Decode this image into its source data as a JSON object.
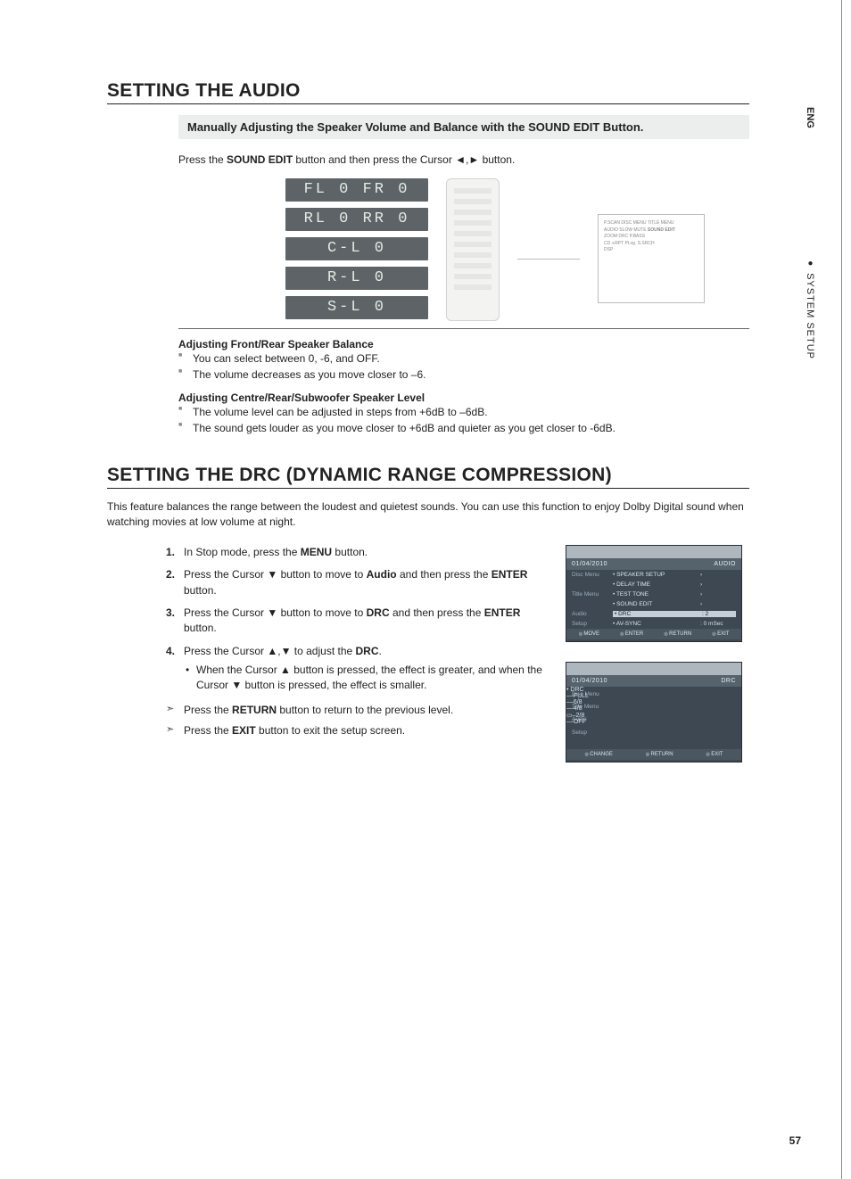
{
  "sideTab": "ENG",
  "sideSection": "SYSTEM SETUP",
  "section1": {
    "title": "SETTING THE AUDIO",
    "subhead": "Manually Adjusting the Speaker Volume and Balance with the SOUND EDIT Button.",
    "intro_pre": "Press the ",
    "intro_bold1": "SOUND EDIT",
    "intro_mid": " button and then press the Cursor ◄,► button.",
    "displays": [
      "FL 0 FR 0",
      "RL 0 RR 0",
      "C-L   0",
      "R-L   0",
      "S-L   0"
    ],
    "blockA_head": "Adjusting Front/Rear Speaker Balance",
    "blockA_items": [
      "You can select between 0, -6, and OFF.",
      "The volume decreases as you move closer to –6."
    ],
    "blockB_head": "Adjusting Centre/Rear/Subwoofer Speaker Level",
    "blockB_items": [
      "The volume level can be adjusted in steps from +6dB to –6dB.",
      "The sound gets louder as you move closer to +6dB and quieter as you get closer to -6dB."
    ]
  },
  "section2": {
    "title": "SETTING THE DRC (DYNAMIC RANGE COMPRESSION)",
    "desc": "This feature balances the range between the loudest and quietest sounds. You can use this function to enjoy Dolby Digital sound when watching movies at low volume at night.",
    "steps": [
      {
        "num": "1.",
        "parts": [
          "In Stop mode, press the ",
          "MENU",
          " button."
        ]
      },
      {
        "num": "2.",
        "parts": [
          "Press the Cursor ▼ button to move to ",
          "Audio",
          " and then press the ",
          "ENTER",
          " button."
        ]
      },
      {
        "num": "3.",
        "parts": [
          "Press the Cursor ▼ button to move to ",
          "DRC",
          " and then press the ",
          "ENTER",
          " button."
        ]
      },
      {
        "num": "4.",
        "parts": [
          "Press the Cursor ▲,▼ to adjust the ",
          "DRC",
          "."
        ]
      }
    ],
    "sub_bullet": "When the Cursor ▲ button is pressed, the effect is greater, and when the Cursor ▼ button is pressed, the effect is smaller.",
    "pointers": [
      {
        "pre": "Press the ",
        "bold": "RETURN",
        "post": " button to return to the previous level."
      },
      {
        "pre": "Press the ",
        "bold": "EXIT",
        "post": " button to exit the setup screen."
      }
    ]
  },
  "osd1": {
    "title_left": "01/04/2010",
    "title_right": "AUDIO",
    "rows": [
      {
        "lab": "Disc Menu",
        "menu": "• SPEAKER SETUP",
        "val": "›"
      },
      {
        "lab": "",
        "menu": "• DELAY TIME",
        "val": "›"
      },
      {
        "lab": "Title Menu",
        "menu": "• TEST TONE",
        "val": "›"
      },
      {
        "lab": "",
        "menu": "• SOUND EDIT",
        "val": "›"
      },
      {
        "lab": "Audio",
        "menu": "• DRC",
        "val": ": 2",
        "selected": true
      },
      {
        "lab": "Setup",
        "menu": "• AV-SYNC",
        "val": ": 0 mSec"
      }
    ],
    "footer": [
      "MOVE",
      "ENTER",
      "RETURN",
      "EXIT"
    ]
  },
  "osd2": {
    "title_left": "01/04/2010",
    "title_right": "DRC",
    "left_labels": [
      "Disc Menu",
      "Title Menu",
      "Audio",
      "Setup"
    ],
    "drc_label": "• DRC",
    "levels": [
      "FULL",
      "6/8",
      "4/8",
      "2/8",
      "OFF"
    ],
    "selected_level": "2/8",
    "footer": [
      "CHANGE",
      "RETURN",
      "EXIT"
    ]
  },
  "callout_labels": [
    "P.SCAN",
    "DISC MENU",
    "TITLE MENU",
    "AUDIO",
    "SLOW",
    "MUTE",
    "ZOOM",
    "DRC",
    "P.BASS",
    "CD",
    "∞RPT",
    "Pt.vg.",
    "S.SRCH",
    "DSP",
    "SOUND EDIT"
  ],
  "pageNumber": "57"
}
